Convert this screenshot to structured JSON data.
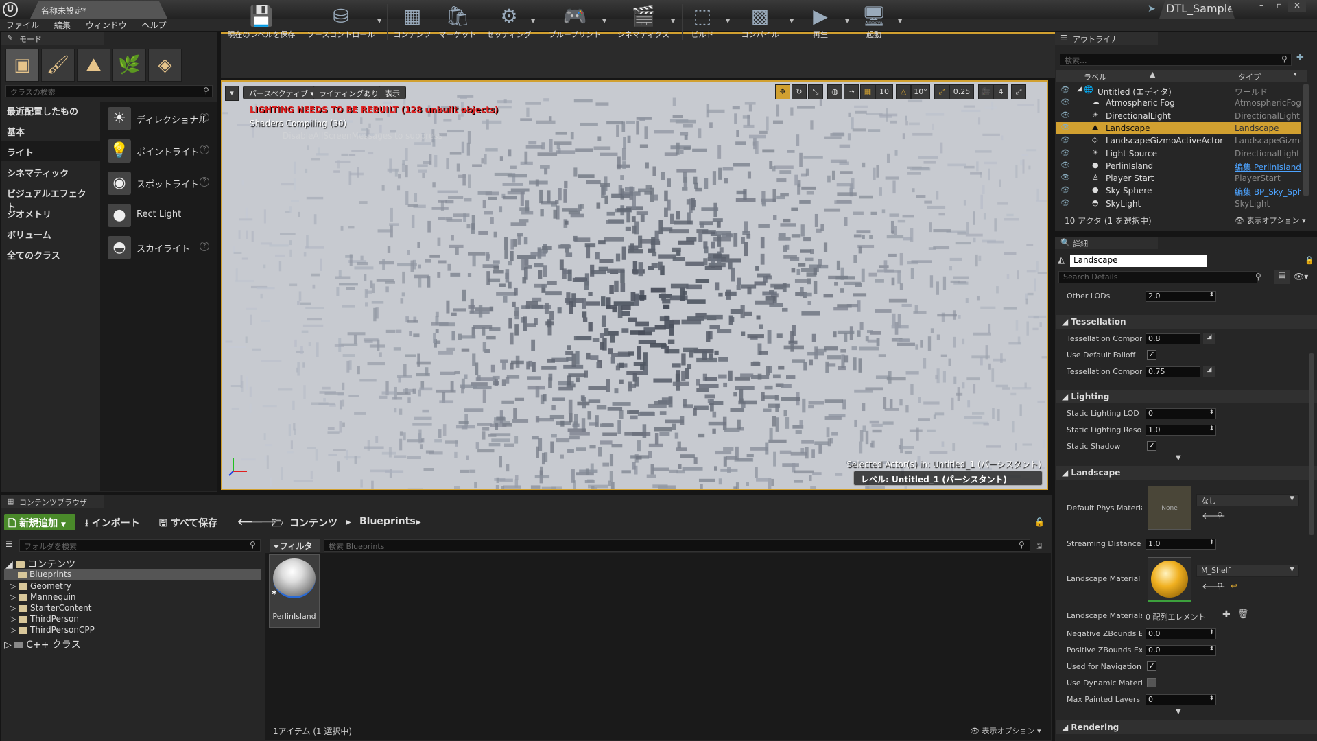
{
  "titlebar": {
    "logo": "U",
    "doc_tab": "名称未設定*",
    "project": "DTL_Sample",
    "win_min": "–",
    "win_max": "▫",
    "win_close": "✕"
  },
  "menu": [
    "ファイル",
    "編集",
    "ウィンドウ",
    "ヘルプ"
  ],
  "modes": {
    "tab": "モード",
    "search_placeholder": "クラスの検索",
    "categories": [
      "最近配置したもの",
      "基本",
      "ライト",
      "シネマティック",
      "ビジュアルエフェクト",
      "ジオメトリ",
      "ボリューム",
      "全てのクラス"
    ],
    "selected_category": "ライト",
    "items": [
      "ディレクショナル",
      "ポイントライト",
      "スポットライト",
      "Rect Light",
      "スカイライト"
    ],
    "help": "?"
  },
  "toolbar": {
    "buttons": [
      "現在のレベルを保存",
      "ソースコントロール",
      "コンテンツ",
      "マーケット",
      "セッティング",
      "ブループリント",
      "シネマティクス",
      "ビルド",
      "コンパイル",
      "再生",
      "起動"
    ]
  },
  "viewport": {
    "perspective": "パースペクティブ",
    "lighting": "ライティングあり",
    "show": "表示",
    "grid_snap": "10",
    "rot_snap": "10°",
    "scale_snap": "0.25",
    "cam_speed": "4",
    "warn_lighting": "LIGHTING NEEDS TO BE REBUILT (128 unbuilt objects)",
    "warn_shaders": "Shaders Compiling (30)",
    "warn_disable": "DisableAllScreenMessages to suppress",
    "selected_actor": "Selected Actor(s) in:  Untitled_1 (パーシスタント)",
    "level": "レベル:  Untitled_1 (パーシスタント)"
  },
  "outliner": {
    "tab": "アウトライナ",
    "search_placeholder": "検索...",
    "col_label": "ラベル",
    "col_type": "タイプ",
    "rows": [
      {
        "name": "Untitled (エディタ)",
        "type": "ワールド",
        "link": false
      },
      {
        "name": "Atmospheric Fog",
        "type": "AtmosphericFog",
        "link": false
      },
      {
        "name": "DirectionalLight",
        "type": "DirectionalLight",
        "link": false
      },
      {
        "name": "Landscape",
        "type": "Landscape",
        "link": false
      },
      {
        "name": "LandscapeGizmoActiveActor",
        "type": "LandscapeGizmoActiveActor",
        "link": false
      },
      {
        "name": "Light Source",
        "type": "DirectionalLight",
        "link": false
      },
      {
        "name": "PerlinIsland",
        "type": "編集 PerlinIsland",
        "link": true
      },
      {
        "name": "Player Start",
        "type": "PlayerStart",
        "link": false
      },
      {
        "name": "Sky Sphere",
        "type": "編集 BP_Sky_Sphere",
        "link": true
      },
      {
        "name": "SkyLight",
        "type": "SkyLight",
        "link": false
      }
    ],
    "selected_row": "Landscape",
    "status": "10 アクタ (1 を選択中)",
    "view_options": "表示オプション"
  },
  "details": {
    "tab": "詳細",
    "actor_name": "Landscape",
    "search_placeholder": "Search Details",
    "other_lods_label": "Other LODs",
    "other_lods": "2.0",
    "sections": [
      "Tessellation",
      "Lighting",
      "Landscape",
      "Rendering"
    ],
    "tess_comp1_label": "Tessellation Component Screen Size",
    "tess_comp1": "0.8",
    "use_default_falloff_label": "Use Default Falloff",
    "tess_comp2_label": "Tessellation Component Screen Size Falloff",
    "tess_comp2": "0.75",
    "static_lod_label": "Static Lighting LOD",
    "static_lod": "0",
    "static_res_label": "Static Lighting Resolution",
    "static_res": "1.0",
    "static_shadow_label": "Static Shadow",
    "phys_mat_label": "Default Phys Material",
    "phys_mat_swatch": "None",
    "phys_mat_combo": "なし",
    "stream_label": "Streaming Distance Multiplier",
    "stream": "1.0",
    "land_mat_label": "Landscape Material",
    "land_mat_combo": "M_Shelf",
    "land_mats_label": "Landscape Materials Override",
    "land_mats_value": "0 配列エレメント",
    "neg_z_label": "Negative ZBounds Extension",
    "neg_z": "0.0",
    "pos_z_label": "Positive ZBounds Extension",
    "pos_z": "0.0",
    "used_nav_label": "Used for Navigation",
    "dyn_mat_label": "Use Dynamic Material Instance",
    "max_layers_label": "Max Painted Layers Per Component",
    "max_layers": "0",
    "colors": {
      "material_sphere": "#f0b020"
    }
  },
  "content_browser": {
    "tab": "コンテンツブラウザ",
    "new_add": "新規追加",
    "import": "インポート",
    "save_all": "すべて保存",
    "breadcrumb_root": "コンテンツ",
    "breadcrumb_folder": "Blueprints",
    "folder_search_placeholder": "フォルダを検索",
    "filter": "フィルタ",
    "asset_search_placeholder": "検索 Blueprints",
    "tree": {
      "root": "コンテンツ",
      "children": [
        "Blueprints",
        "Geometry",
        "Mannequin",
        "StarterContent",
        "ThirdPerson",
        "ThirdPersonCPP"
      ],
      "cpp": "C++ クラス"
    },
    "asset_name": "PerlinIsland",
    "status": "1アイテム (1 選択中)",
    "view_options": "表示オプション"
  }
}
